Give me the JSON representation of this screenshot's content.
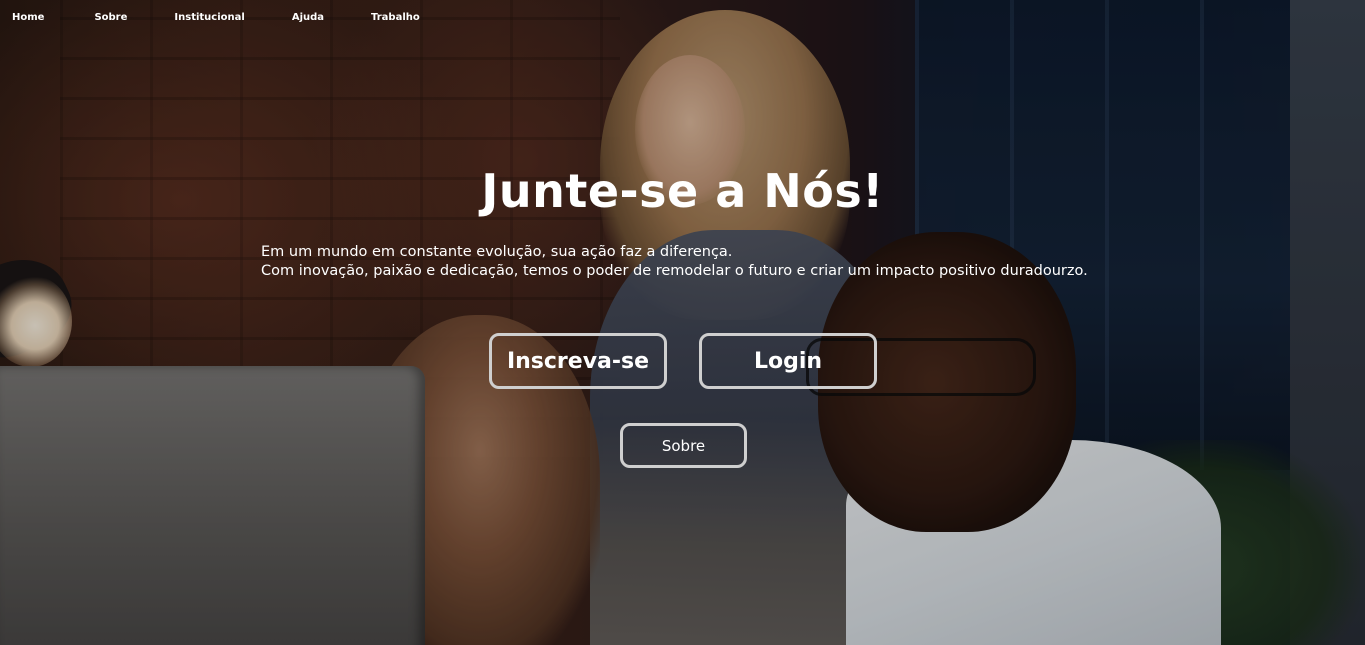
{
  "nav": {
    "items": [
      {
        "label": "Home"
      },
      {
        "label": "Sobre"
      },
      {
        "label": "Institucional"
      },
      {
        "label": "Ajuda"
      },
      {
        "label": "Trabalho"
      }
    ]
  },
  "hero": {
    "title": "Junte-se a Nós!",
    "text_line1": "Em um mundo em constante evolução, sua ação faz a diferença.",
    "text_line2": "Com inovação, paixão e dedicação, temos o poder de remodelar o futuro e criar um impacto positivo duradourzo.",
    "signup_label": "Inscreva-se",
    "login_label": "Login",
    "about_label": "Sobre"
  },
  "colors": {
    "text": "#ffffff",
    "button_border": "#cfcfcf"
  }
}
